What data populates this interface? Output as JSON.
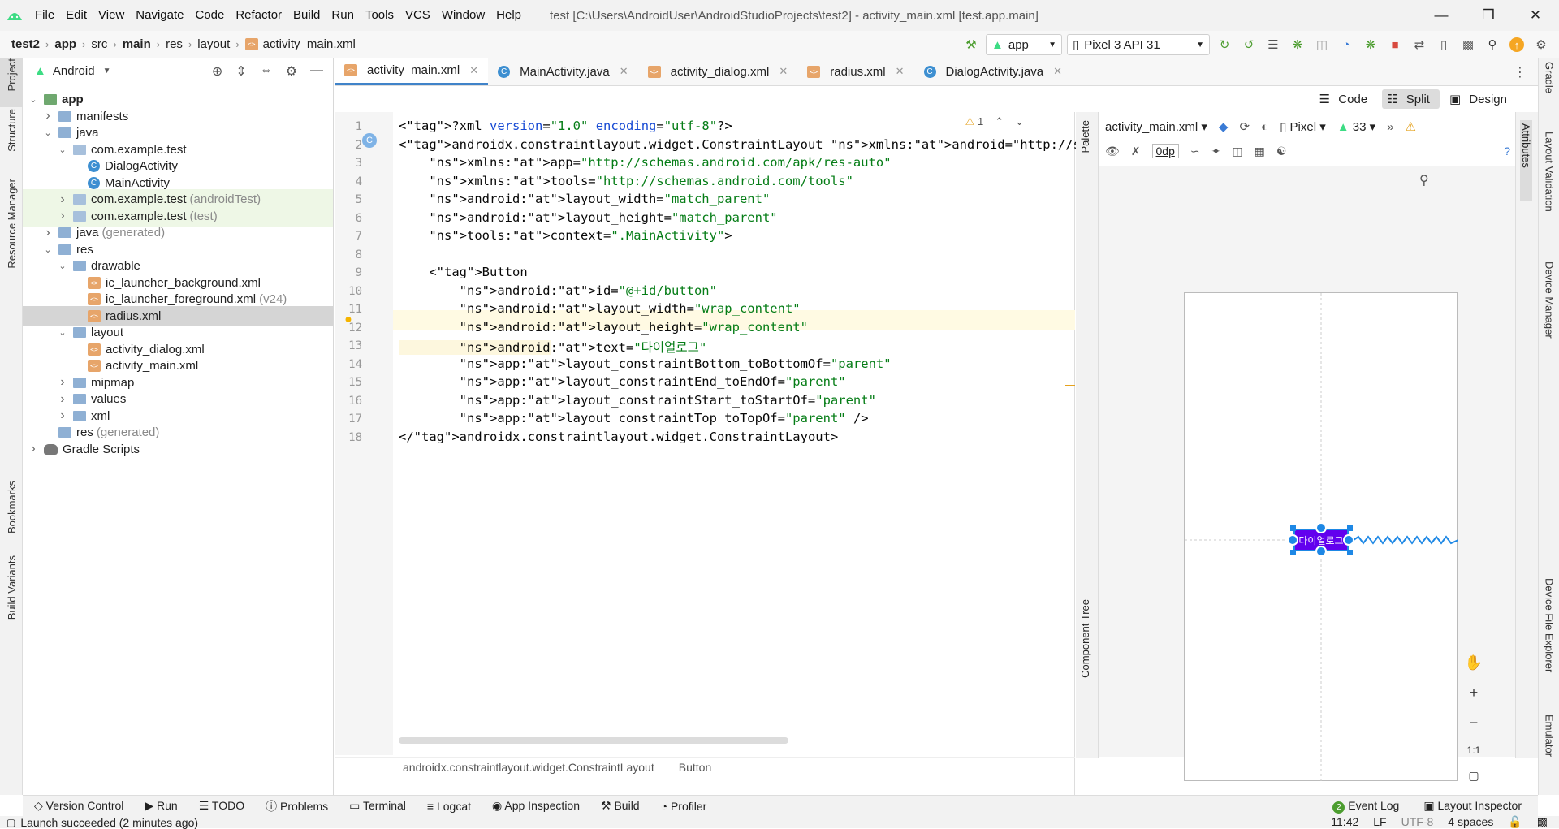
{
  "window": {
    "menu": [
      "File",
      "Edit",
      "View",
      "Navigate",
      "Code",
      "Refactor",
      "Build",
      "Run",
      "Tools",
      "VCS",
      "Window",
      "Help"
    ],
    "title": "test [C:\\Users\\AndroidUser\\AndroidStudioProjects\\test2] - activity_main.xml [test.app.main]"
  },
  "breadcrumb": [
    "test2",
    "app",
    "src",
    "main",
    "res",
    "layout",
    "activity_main.xml"
  ],
  "toolbar": {
    "run_config": "app",
    "device": "Pixel 3 API 31"
  },
  "left_strip": [
    "Project",
    "Structure",
    "Resource Manager",
    "Bookmarks",
    "Build Variants"
  ],
  "right_strip": [
    "Gradle",
    "Layout Validation",
    "Device Manager",
    "Device File Explorer",
    "Emulator"
  ],
  "project": {
    "view_name": "Android",
    "tree": [
      {
        "label": "app",
        "level": 0,
        "type": "module",
        "arrow": "down"
      },
      {
        "label": "manifests",
        "level": 1,
        "type": "folder",
        "arrow": "right"
      },
      {
        "label": "java",
        "level": 1,
        "type": "folder",
        "arrow": "down"
      },
      {
        "label": "com.example.test",
        "level": 2,
        "type": "pkg",
        "arrow": "down"
      },
      {
        "label": "DialogActivity",
        "level": 3,
        "type": "class"
      },
      {
        "label": "MainActivity",
        "level": 3,
        "type": "class"
      },
      {
        "label": "com.example.test",
        "suffix": "(androidTest)",
        "level": 2,
        "type": "pkg",
        "arrow": "right",
        "style": "test"
      },
      {
        "label": "com.example.test",
        "suffix": "(test)",
        "level": 2,
        "type": "pkg",
        "arrow": "right",
        "style": "test"
      },
      {
        "label": "java",
        "suffix": "(generated)",
        "level": 1,
        "type": "folder",
        "arrow": "right"
      },
      {
        "label": "res",
        "level": 1,
        "type": "folder",
        "arrow": "down"
      },
      {
        "label": "drawable",
        "level": 2,
        "type": "folder",
        "arrow": "down"
      },
      {
        "label": "ic_launcher_background.xml",
        "level": 3,
        "type": "xml"
      },
      {
        "label": "ic_launcher_foreground.xml",
        "suffix": "(v24)",
        "level": 3,
        "type": "xml"
      },
      {
        "label": "radius.xml",
        "level": 3,
        "type": "xml",
        "style": "sel"
      },
      {
        "label": "layout",
        "level": 2,
        "type": "folder",
        "arrow": "down"
      },
      {
        "label": "activity_dialog.xml",
        "level": 3,
        "type": "xml"
      },
      {
        "label": "activity_main.xml",
        "level": 3,
        "type": "xml"
      },
      {
        "label": "mipmap",
        "level": 2,
        "type": "folder",
        "arrow": "right"
      },
      {
        "label": "values",
        "level": 2,
        "type": "folder",
        "arrow": "right"
      },
      {
        "label": "xml",
        "level": 2,
        "type": "folder",
        "arrow": "right"
      },
      {
        "label": "res",
        "suffix": "(generated)",
        "level": 1,
        "type": "folder"
      },
      {
        "label": "Gradle Scripts",
        "level": 0,
        "type": "gradle",
        "arrow": "right"
      }
    ]
  },
  "tabs": [
    {
      "label": "activity_main.xml",
      "icon": "xml",
      "active": true
    },
    {
      "label": "MainActivity.java",
      "icon": "class"
    },
    {
      "label": "activity_dialog.xml",
      "icon": "xml"
    },
    {
      "label": "radius.xml",
      "icon": "xml"
    },
    {
      "label": "DialogActivity.java",
      "icon": "class"
    }
  ],
  "modes": [
    "Code",
    "Split",
    "Design"
  ],
  "code_lines": [
    "<?xml version=\"1.0\" encoding=\"utf-8\"?>",
    "<androidx.constraintlayout.widget.ConstraintLayout xmlns:android=\"http://schemas.an",
    "    xmlns:app=\"http://schemas.android.com/apk/res-auto\"",
    "    xmlns:tools=\"http://schemas.android.com/tools\"",
    "    android:layout_width=\"match_parent\"",
    "    android:layout_height=\"match_parent\"",
    "    tools:context=\".MainActivity\">",
    "",
    "    <Button",
    "        android:id=\"@+id/button\"",
    "        android:layout_width=\"wrap_content\"",
    "        android:layout_height=\"wrap_content\"",
    "        android:text=\"다이얼로그\"",
    "        app:layout_constraintBottom_toBottomOf=\"parent\"",
    "        app:layout_constraintEnd_toEndOf=\"parent\"",
    "        app:layout_constraintStart_toStartOf=\"parent\"",
    "        app:layout_constraintTop_toTopOf=\"parent\" />",
    "</androidx.constraintlayout.widget.ConstraintLayout>"
  ],
  "warning_count": "1",
  "code_breadcrumb": [
    "androidx.constraintlayout.widget.ConstraintLayout",
    "Button"
  ],
  "preview": {
    "file": "activity_main.xml",
    "device": "Pixel",
    "api": "33",
    "margin": "0dp",
    "button_text": "다이얼로그",
    "palette_label": "Palette",
    "component_tree_label": "Component Tree",
    "attributes_label": "Attributes",
    "zoom_ratio": "1:1"
  },
  "bottom_tabs": [
    "Version Control",
    "Run",
    "TODO",
    "Problems",
    "Terminal",
    "Logcat",
    "App Inspection",
    "Build",
    "Profiler"
  ],
  "bottom_right": {
    "event_log": "Event Log",
    "event_count": "2",
    "layout_inspector": "Layout Inspector"
  },
  "status": {
    "message": "Launch succeeded (2 minutes ago)",
    "time": "11:42",
    "line_sep": "LF",
    "encoding": "UTF-8",
    "indent": "4 spaces"
  }
}
